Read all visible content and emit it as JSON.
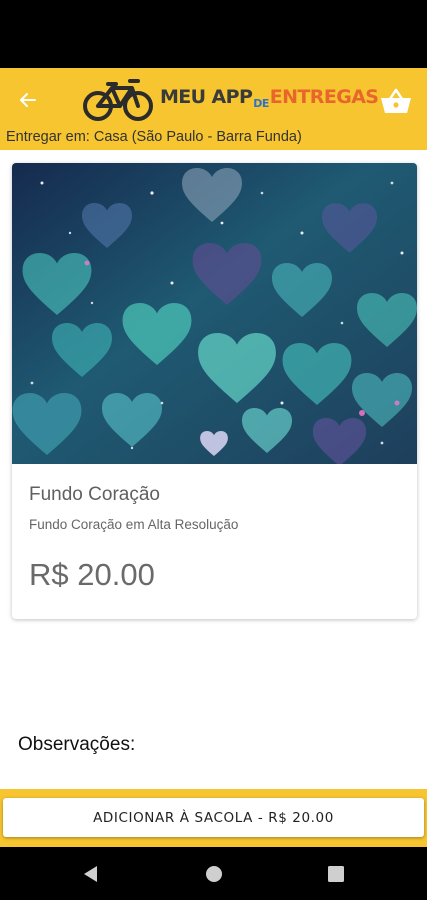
{
  "app_bar": {
    "back_icon": "arrow-left-icon",
    "logo": {
      "word1": "MEU APP",
      "word2": "DE",
      "word3": "ENTREGAS"
    },
    "cart_icon": "basket-icon",
    "deliver_text": "Entregar em: Casa (São Paulo - Barra Funda)"
  },
  "product": {
    "image_icon": "hearts-galaxy-image",
    "title": "Fundo Coração",
    "description": "Fundo Coração em Alta Resolução",
    "price": "R$ 20.00"
  },
  "observations": {
    "label": "Observações:"
  },
  "bottom": {
    "add_button_label": "ADICIONAR À SACOLA - R$ 20.00"
  },
  "nav": {
    "back_icon": "nav-back-icon",
    "home_icon": "nav-home-icon",
    "recents_icon": "nav-recents-icon"
  },
  "colors": {
    "accent": "#f6c52f",
    "logo_blue": "#2f72c8",
    "logo_orange": "#e8662c"
  }
}
